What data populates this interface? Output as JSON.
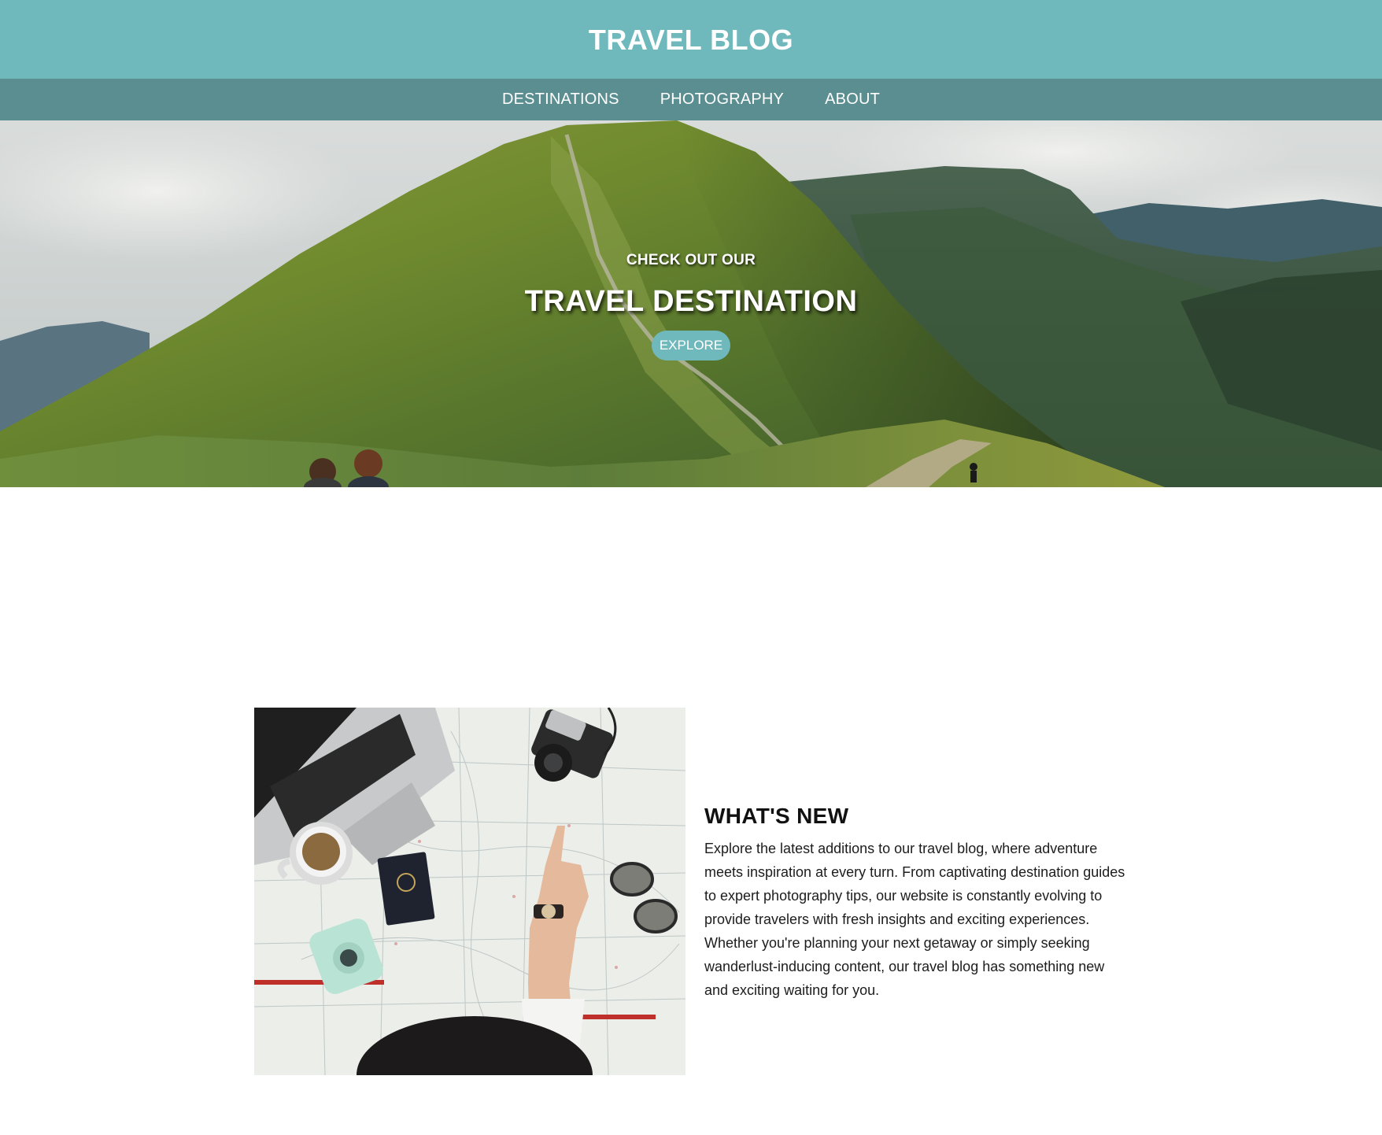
{
  "site": {
    "title": "TRAVEL BLOG"
  },
  "nav": {
    "items": [
      {
        "label": "DESTINATIONS"
      },
      {
        "label": "PHOTOGRAPHY"
      },
      {
        "label": "ABOUT"
      }
    ]
  },
  "hero": {
    "kicker": "CHECK OUT OUR",
    "title": "TRAVEL DESTINATION",
    "button_label": "EXPLORE",
    "image": "mountain-ridge-hikers-photo"
  },
  "news": {
    "heading": "WHAT'S NEW",
    "body": "Explore the latest additions to our travel blog, where adventure meets inspiration at every turn. From captivating destination guides to expert photography tips, our website is constantly evolving to provide travelers with fresh insights and exciting experiences. Whether you're planning your next getaway or simply seeking wanderlust-inducing content, our travel blog has something new and exciting waiting for you.",
    "image": "map-laptop-camera-passport-photo"
  },
  "colors": {
    "header": "#6fb9bc",
    "nav": "#5b8e91",
    "button": "#6fb9bc"
  }
}
